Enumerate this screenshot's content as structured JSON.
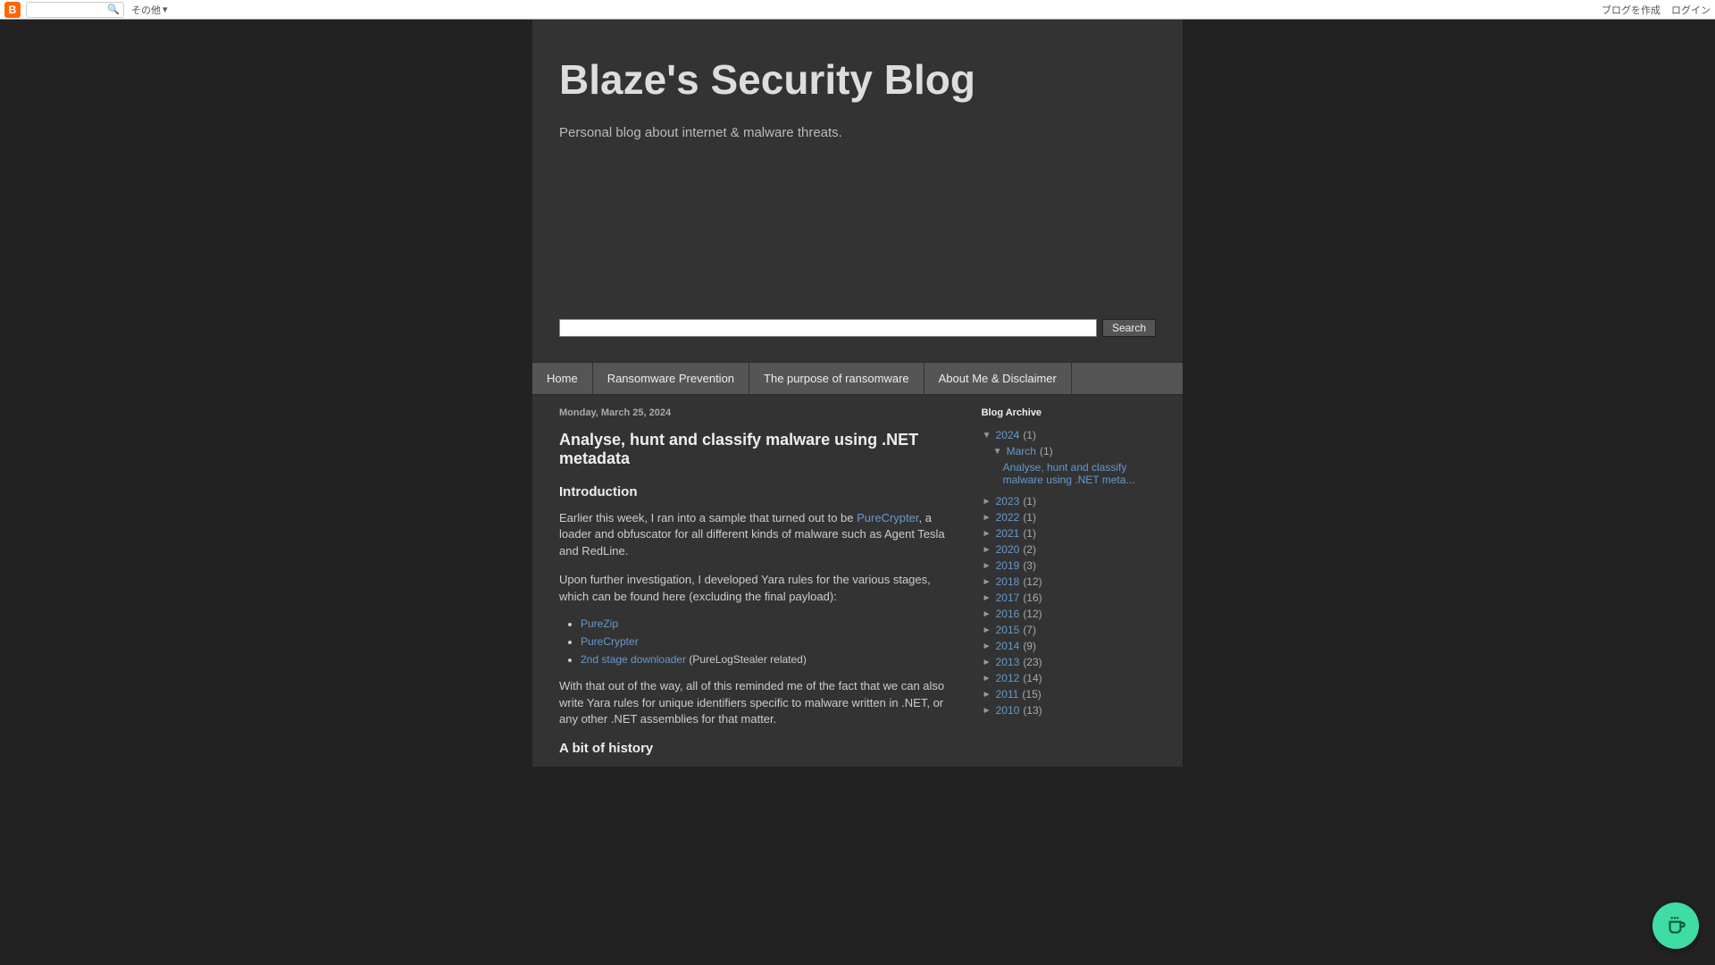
{
  "topbar": {
    "more_label": "その他",
    "create_blog": "ブログを作成",
    "login": "ログイン"
  },
  "blog": {
    "title": "Blaze's Security Blog",
    "subtitle": "Personal blog about internet & malware threats."
  },
  "search": {
    "button": "Search"
  },
  "nav": {
    "home": "Home",
    "ransomware_prevention": "Ransomware Prevention",
    "purpose": "The purpose of ransomware",
    "about": "About Me & Disclaimer"
  },
  "post": {
    "date": "Monday, March 25, 2024",
    "title": "Analyse, hunt and classify malware using .NET metadata",
    "intro_heading": "Introduction",
    "para1_pre": "Earlier this week, I ran into a sample that turned out to be ",
    "para1_link": "PureCrypter",
    "para1_post": ", a loader and obfuscator for all different kinds of malware such as Agent Tesla and RedLine.",
    "para2": "Upon further investigation, I developed Yara rules for the various stages, which can be found here (excluding the final payload):",
    "list": {
      "purezip": "PureZip",
      "purecrypter": "PureCrypter",
      "stage2_link": "2nd stage downloader",
      "stage2_note": " (PureLogStealer related)"
    },
    "para3": "With that out of the way, all of this reminded me of the fact that we can also write Yara rules for unique identifiers specific to malware written in .NET, or any other .NET assemblies for that matter.",
    "history_heading": "A bit of history"
  },
  "sidebar": {
    "archive_heading": "Blog Archive",
    "expanded_year": {
      "year": "2024",
      "count": "(1)"
    },
    "expanded_month": {
      "month": "March",
      "count": "(1)"
    },
    "current_post_link": "Analyse, hunt and classify malware using .NET meta...",
    "years": [
      {
        "year": "2023",
        "count": "(1)"
      },
      {
        "year": "2022",
        "count": "(1)"
      },
      {
        "year": "2021",
        "count": "(1)"
      },
      {
        "year": "2020",
        "count": "(2)"
      },
      {
        "year": "2019",
        "count": "(3)"
      },
      {
        "year": "2018",
        "count": "(12)"
      },
      {
        "year": "2017",
        "count": "(16)"
      },
      {
        "year": "2016",
        "count": "(12)"
      },
      {
        "year": "2015",
        "count": "(7)"
      },
      {
        "year": "2014",
        "count": "(9)"
      },
      {
        "year": "2013",
        "count": "(23)"
      },
      {
        "year": "2012",
        "count": "(14)"
      },
      {
        "year": "2011",
        "count": "(15)"
      },
      {
        "year": "2010",
        "count": "(13)"
      }
    ]
  }
}
